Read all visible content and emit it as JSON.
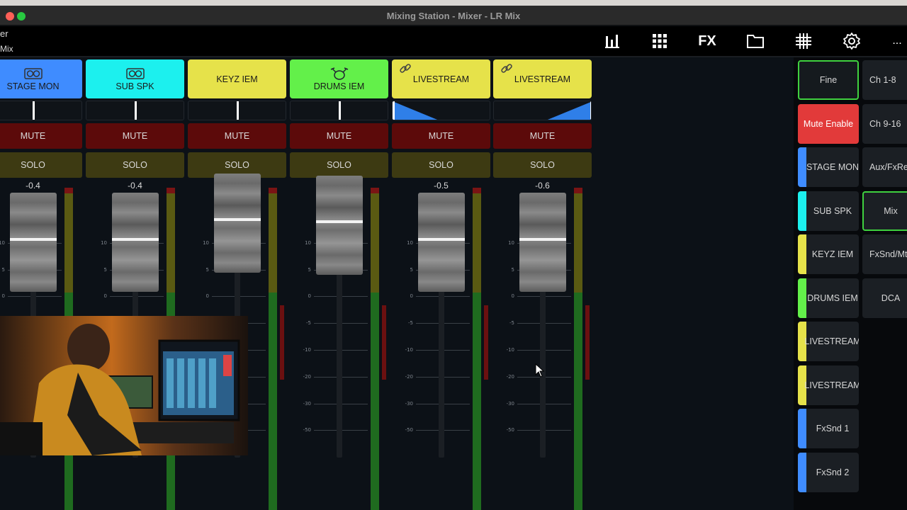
{
  "window": {
    "title": "Mixing Station - Mixer - LR Mix"
  },
  "header": {
    "line1": "er",
    "line2": "Mix"
  },
  "toolbar": {
    "icons": [
      "meters-icon",
      "grid-icon",
      "fx-button",
      "folder-icon",
      "matrix-icon",
      "gear-icon",
      "more-icon"
    ],
    "fx_label": "FX",
    "more_label": "..."
  },
  "channels": [
    {
      "name": "STAGE MON",
      "color": "#3f8cff",
      "icon": "speaker-icon",
      "pan": 0.5,
      "mute": "MUTE",
      "solo": "SOLO",
      "gain": "-0.4"
    },
    {
      "name": "SUB SPK",
      "color": "#1cf0ee",
      "icon": "speaker-icon",
      "pan": 0.5,
      "mute": "MUTE",
      "solo": "SOLO",
      "gain": "-0.4"
    },
    {
      "name": "KEYZ IEM",
      "color": "#e6e24a",
      "icon": "",
      "pan": 0.5,
      "mute": "MUTE",
      "solo": "SOLO",
      "gain": "+3.3"
    },
    {
      "name": "DRUMS IEM",
      "color": "#63f04a",
      "icon": "drums-icon",
      "pan": 0.5,
      "mute": "MUTE",
      "solo": "SOLO",
      "gain": "+2.9"
    },
    {
      "name": "LIVESTREAM",
      "color": "#e6e24a",
      "icon": "link-icon",
      "pan": 0.0,
      "mute": "MUTE",
      "solo": "SOLO",
      "gain": "-0.5"
    },
    {
      "name": "LIVESTREAM",
      "color": "#e6e24a",
      "icon": "link-icon",
      "pan": 1.0,
      "mute": "MUTE",
      "solo": "SOLO",
      "gain": "-0.6"
    }
  ],
  "scale_labels": [
    "10",
    "5",
    "0",
    "-5",
    "-10",
    "-20",
    "-30",
    "-50"
  ],
  "right_panel": {
    "col1": [
      {
        "label": "Fine",
        "color": "",
        "outline": "#3fd13f"
      },
      {
        "label": "Mute Enable",
        "color": "#e23a3a",
        "outline": ""
      },
      {
        "label": "STAGE MON",
        "color": "#3f8cff",
        "outline": ""
      },
      {
        "label": "SUB SPK",
        "color": "#1cf0ee",
        "outline": ""
      },
      {
        "label": "KEYZ IEM",
        "color": "#e6e24a",
        "outline": ""
      },
      {
        "label": "DRUMS IEM",
        "color": "#63f04a",
        "outline": ""
      },
      {
        "label": "LIVESTREAM",
        "color": "#e6e24a",
        "outline": ""
      },
      {
        "label": "LIVESTREAM",
        "color": "#e6e24a",
        "outline": ""
      },
      {
        "label": "FxSnd 1",
        "color": "#3f8cff",
        "outline": ""
      },
      {
        "label": "FxSnd 2",
        "color": "#3f8cff",
        "outline": ""
      }
    ],
    "col2": [
      {
        "label": "Ch 1-8",
        "outline": ""
      },
      {
        "label": "Ch 9-16",
        "outline": ""
      },
      {
        "label": "Aux/FxRet",
        "outline": ""
      },
      {
        "label": "Mix",
        "outline": "#3fd13f"
      },
      {
        "label": "FxSnd/Mtx",
        "outline": ""
      },
      {
        "label": "DCA",
        "outline": ""
      }
    ]
  },
  "colors": {
    "mute_bg": "#5c0a0a",
    "solo_bg": "#3d3a12",
    "panel_bg": "#0c1117",
    "accent_green": "#3fd13f"
  }
}
